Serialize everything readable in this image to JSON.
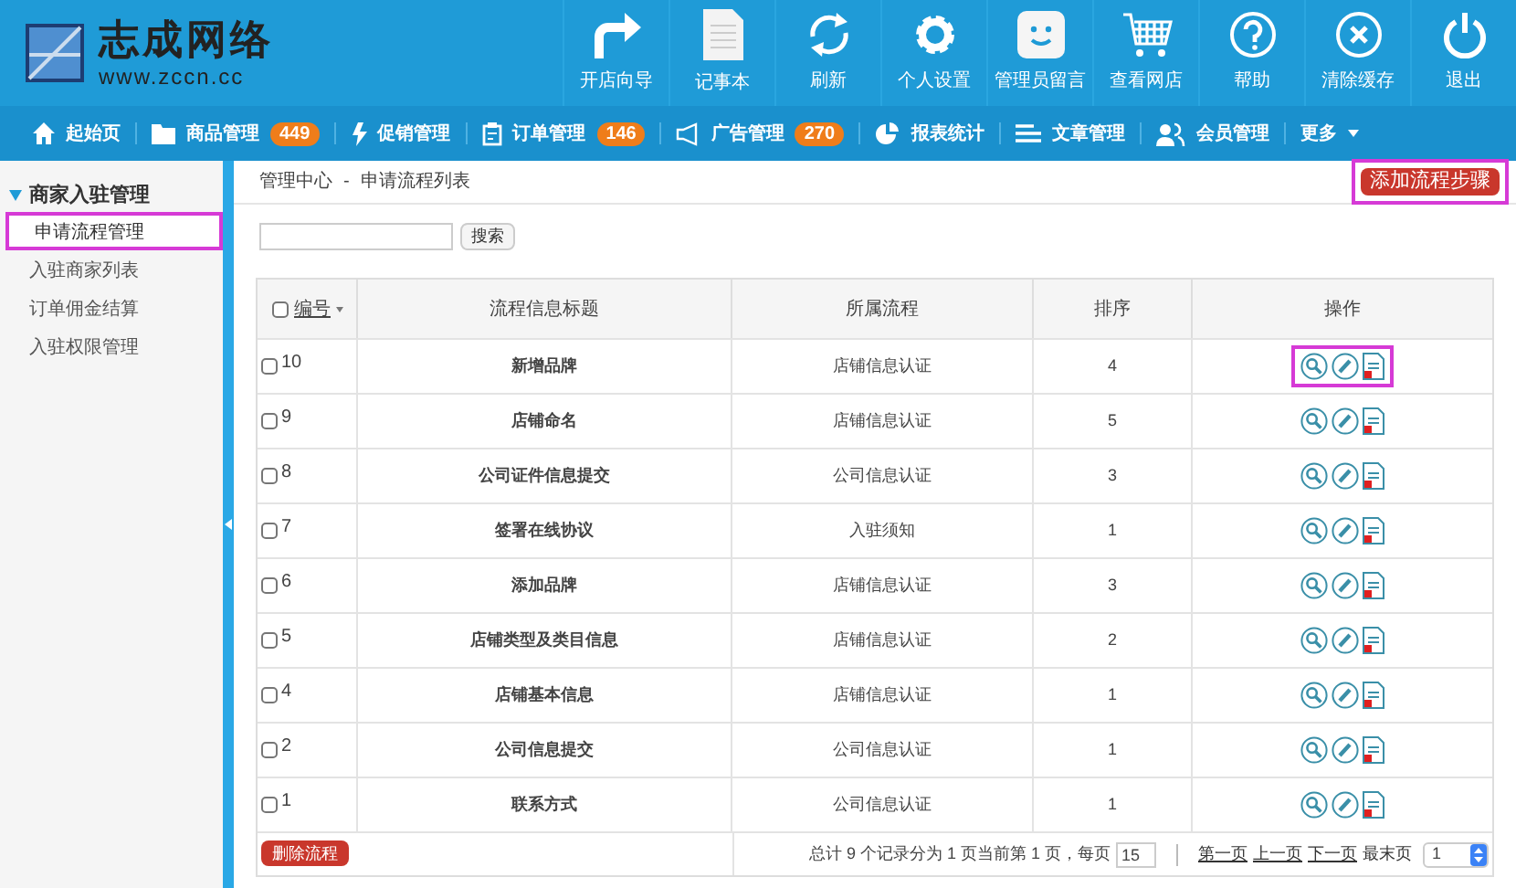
{
  "logo": {
    "title": "志成网络",
    "url": "www.zccn.cc"
  },
  "toolbar": [
    {
      "label": "开店向导"
    },
    {
      "label": "记事本"
    },
    {
      "label": "刷新"
    },
    {
      "label": "个人设置"
    },
    {
      "label": "管理员留言"
    },
    {
      "label": "查看网店"
    },
    {
      "label": "帮助"
    },
    {
      "label": "清除缓存"
    },
    {
      "label": "退出"
    }
  ],
  "nav": [
    {
      "label": "起始页",
      "dropdown": false
    },
    {
      "label": "商品管理",
      "badge": "449",
      "dropdown": false
    },
    {
      "label": "促销管理",
      "dropdown": false
    },
    {
      "label": "订单管理",
      "badge": "146",
      "dropdown": false
    },
    {
      "label": "广告管理",
      "badge": "270",
      "dropdown": false
    },
    {
      "label": "报表统计",
      "dropdown": false
    },
    {
      "label": "文章管理",
      "dropdown": false
    },
    {
      "label": "会员管理",
      "dropdown": false
    },
    {
      "label": "更多",
      "dropdown": true
    }
  ],
  "sidebar": {
    "title": "商家入驻管理",
    "expanded": true,
    "items": [
      {
        "label": "申请流程管理",
        "selected": true,
        "highlighted": true
      },
      {
        "label": "入驻商家列表",
        "selected": false,
        "highlighted": false
      },
      {
        "label": "订单佣金结算",
        "selected": false,
        "highlighted": false
      },
      {
        "label": "入驻权限管理",
        "selected": false,
        "highlighted": false
      }
    ]
  },
  "breadcrumb": [
    "管理中心",
    "-",
    "申请流程列表"
  ],
  "add_button": {
    "label": "添加流程步骤",
    "highlighted": true
  },
  "search": {
    "button": "搜索"
  },
  "table": {
    "select_all_checked": false,
    "columns": [
      "编号",
      "流程信息标题",
      "所属流程",
      "排序",
      "操作"
    ],
    "rows": [
      {
        "id": "10",
        "title": "新增品牌",
        "process": "店铺信息认证",
        "order": "4",
        "checked": false,
        "highlighted": true
      },
      {
        "id": "9",
        "title": "店铺命名",
        "process": "店铺信息认证",
        "order": "5",
        "checked": false,
        "highlighted": false
      },
      {
        "id": "8",
        "title": "公司证件信息提交",
        "process": "公司信息认证",
        "order": "3",
        "checked": false,
        "highlighted": false
      },
      {
        "id": "7",
        "title": "签署在线协议",
        "process": "入驻须知",
        "order": "1",
        "checked": false,
        "highlighted": false
      },
      {
        "id": "6",
        "title": "添加品牌",
        "process": "店铺信息认证",
        "order": "3",
        "checked": false,
        "highlighted": false
      },
      {
        "id": "5",
        "title": "店铺类型及类目信息",
        "process": "店铺信息认证",
        "order": "2",
        "checked": false,
        "highlighted": false
      },
      {
        "id": "4",
        "title": "店铺基本信息",
        "process": "店铺信息认证",
        "order": "1",
        "checked": false,
        "highlighted": false
      },
      {
        "id": "2",
        "title": "公司信息提交",
        "process": "公司信息认证",
        "order": "1",
        "checked": false,
        "highlighted": false
      },
      {
        "id": "1",
        "title": "联系方式",
        "process": "公司信息认证",
        "order": "1",
        "checked": false,
        "highlighted": false
      }
    ]
  },
  "footer": {
    "delete_button": "删除流程",
    "summary": "总计 9 个记录分为 1 页当前第 1 页，每页",
    "per_page": "15",
    "links": [
      "第一页",
      "上一页",
      "下一页",
      "最末页"
    ],
    "page": "1"
  }
}
